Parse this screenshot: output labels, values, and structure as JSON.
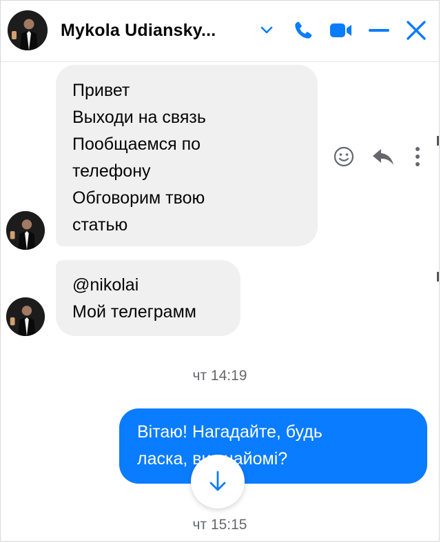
{
  "header": {
    "contact_name": "Mykola Udiansky...",
    "icons": [
      "chevron-down-icon",
      "phone-icon",
      "video-camera-icon",
      "minimize-icon",
      "close-icon"
    ]
  },
  "incoming_messages": [
    {
      "lines": [
        "Привет",
        "Выходи на связь",
        "Пообщаемся по",
        "телефону",
        "Обговорим твою",
        "статью"
      ]
    },
    {
      "lines": [
        "@nikolai",
        "Мой телеграмм"
      ]
    }
  ],
  "message_actions": {
    "icons": [
      "smiley-icon",
      "reply-icon",
      "more-options-icon"
    ]
  },
  "timestamps": [
    "чт 14:19",
    "чт 15:15"
  ],
  "outgoing_message": {
    "lines": [
      "Вітаю! Нагадайте, будь",
      "ласка, ви знайомі?"
    ]
  },
  "colors": {
    "accent": "#0a7cff",
    "incoming_bubble": "#f0f0f0",
    "timestamp_text": "#65676b",
    "text": "#050505"
  }
}
